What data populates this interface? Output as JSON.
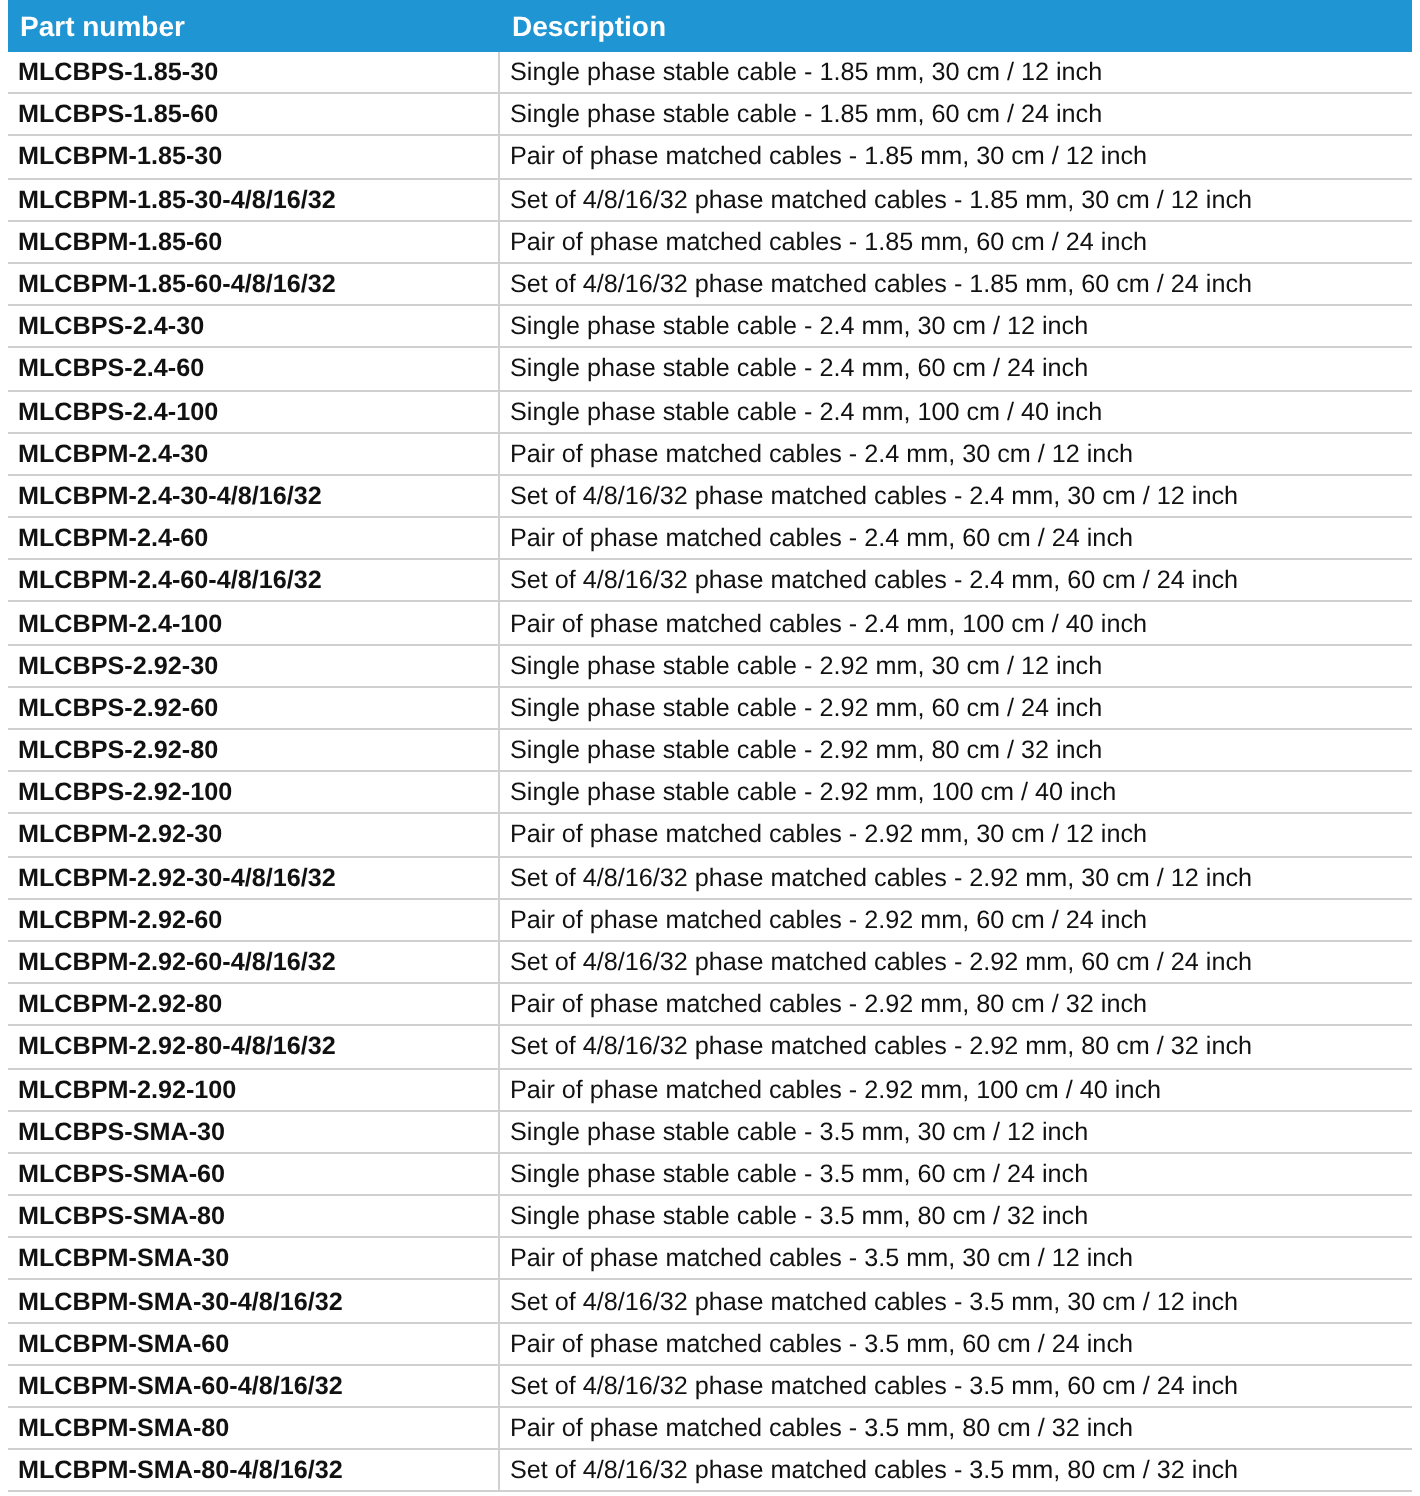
{
  "table": {
    "columns": [
      "Part number",
      "Description"
    ],
    "rows": [
      [
        "MLCBPS-1.85-30",
        "Single phase stable cable - 1.85 mm, 30 cm / 12 inch"
      ],
      [
        "MLCBPS-1.85-60",
        "Single phase stable cable - 1.85 mm, 60 cm / 24 inch"
      ],
      [
        "MLCBPM-1.85-30",
        "Pair of phase matched cables - 1.85 mm, 30 cm / 12 inch"
      ],
      [
        "MLCBPM-1.85-30-4/8/16/32",
        "Set of 4/8/16/32 phase matched cables - 1.85 mm, 30 cm / 12 inch"
      ],
      [
        "MLCBPM-1.85-60",
        "Pair of phase matched cables - 1.85 mm, 60 cm / 24 inch"
      ],
      [
        "MLCBPM-1.85-60-4/8/16/32",
        "Set of 4/8/16/32 phase matched cables - 1.85 mm, 60 cm / 24 inch"
      ],
      [
        "MLCBPS-2.4-30",
        "Single phase stable cable - 2.4 mm, 30 cm / 12 inch"
      ],
      [
        "MLCBPS-2.4-60",
        "Single phase stable cable - 2.4 mm, 60 cm / 24 inch"
      ],
      [
        "MLCBPS-2.4-100",
        "Single phase stable cable - 2.4 mm, 100 cm / 40 inch"
      ],
      [
        "MLCBPM-2.4-30",
        "Pair of phase matched cables - 2.4 mm, 30 cm / 12 inch"
      ],
      [
        "MLCBPM-2.4-30-4/8/16/32",
        "Set of 4/8/16/32 phase matched cables - 2.4 mm, 30 cm / 12 inch"
      ],
      [
        "MLCBPM-2.4-60",
        "Pair of phase matched cables - 2.4 mm, 60 cm / 24 inch"
      ],
      [
        "MLCBPM-2.4-60-4/8/16/32",
        "Set of 4/8/16/32 phase matched cables - 2.4 mm, 60 cm / 24 inch"
      ],
      [
        "MLCBPM-2.4-100",
        "Pair of phase matched cables - 2.4 mm, 100 cm / 40 inch"
      ],
      [
        "MLCBPS-2.92-30",
        "Single phase stable cable - 2.92 mm, 30 cm / 12 inch"
      ],
      [
        "MLCBPS-2.92-60",
        "Single phase stable cable - 2.92 mm, 60 cm / 24 inch"
      ],
      [
        "MLCBPS-2.92-80",
        "Single phase stable cable - 2.92 mm, 80 cm / 32 inch"
      ],
      [
        "MLCBPS-2.92-100",
        "Single phase stable cable - 2.92 mm, 100 cm / 40 inch"
      ],
      [
        "MLCBPM-2.92-30",
        "Pair of phase matched cables - 2.92 mm, 30 cm / 12 inch"
      ],
      [
        "MLCBPM-2.92-30-4/8/16/32",
        "Set of 4/8/16/32 phase matched cables - 2.92 mm, 30 cm / 12 inch"
      ],
      [
        "MLCBPM-2.92-60",
        "Pair of phase matched cables - 2.92 mm, 60 cm / 24 inch"
      ],
      [
        "MLCBPM-2.92-60-4/8/16/32",
        "Set of 4/8/16/32 phase matched cables - 2.92 mm, 60 cm / 24 inch"
      ],
      [
        "MLCBPM-2.92-80",
        "Pair of phase matched cables - 2.92 mm, 80 cm / 32 inch"
      ],
      [
        "MLCBPM-2.92-80-4/8/16/32",
        "Set of 4/8/16/32 phase matched cables - 2.92 mm, 80 cm / 32 inch"
      ],
      [
        "MLCBPM-2.92-100",
        "Pair of phase matched cables - 2.92 mm, 100 cm / 40 inch"
      ],
      [
        "MLCBPS-SMA-30",
        "Single phase stable cable - 3.5 mm, 30 cm / 12 inch"
      ],
      [
        "MLCBPS-SMA-60",
        "Single phase stable cable - 3.5 mm, 60 cm / 24 inch"
      ],
      [
        "MLCBPS-SMA-80",
        "Single phase stable cable - 3.5 mm, 80 cm / 32 inch"
      ],
      [
        "MLCBPM-SMA-30",
        "Pair of phase matched cables - 3.5 mm, 30 cm / 12 inch"
      ],
      [
        "MLCBPM-SMA-30-4/8/16/32",
        "Set of 4/8/16/32 phase matched cables - 3.5 mm, 30 cm / 12 inch"
      ],
      [
        "MLCBPM-SMA-60",
        "Pair of phase matched cables - 3.5 mm, 60 cm / 24 inch"
      ],
      [
        "MLCBPM-SMA-60-4/8/16/32",
        "Set of 4/8/16/32 phase matched cables - 3.5 mm, 60 cm / 24 inch"
      ],
      [
        "MLCBPM-SMA-80",
        "Pair of phase matched cables - 3.5 mm, 80 cm / 32 inch"
      ],
      [
        "MLCBPM-SMA-80-4/8/16/32",
        "Set of 4/8/16/32 phase matched cables - 3.5 mm, 80 cm / 32 inch"
      ]
    ]
  }
}
